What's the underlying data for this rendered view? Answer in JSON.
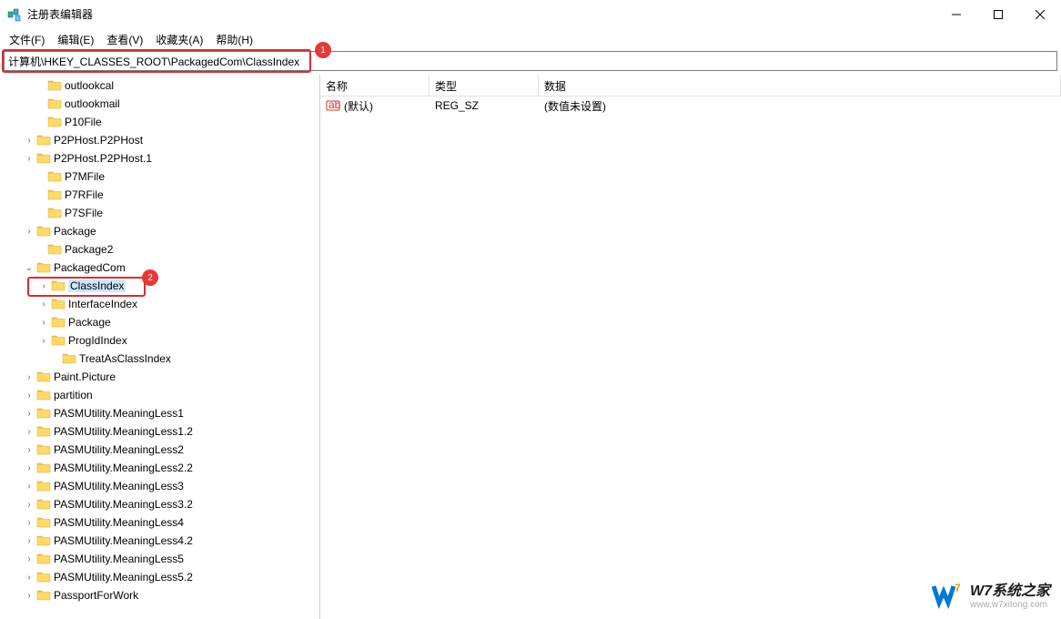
{
  "window": {
    "title": "注册表编辑器"
  },
  "menubar": {
    "file": "文件(F)",
    "edit": "编辑(E)",
    "view": "查看(V)",
    "favorites": "收藏夹(A)",
    "help": "帮助(H)"
  },
  "addressbar": {
    "path": "计算机\\HKEY_CLASSES_ROOT\\PackagedCom\\ClassIndex"
  },
  "annotations": {
    "badge1": "1",
    "badge2": "2"
  },
  "tree": [
    {
      "indent": 38,
      "arrow": "",
      "label": "outlookcal"
    },
    {
      "indent": 38,
      "arrow": "",
      "label": "outlookmail"
    },
    {
      "indent": 38,
      "arrow": "",
      "label": "P10File"
    },
    {
      "indent": 26,
      "arrow": ">",
      "label": "P2PHost.P2PHost"
    },
    {
      "indent": 26,
      "arrow": ">",
      "label": "P2PHost.P2PHost.1"
    },
    {
      "indent": 38,
      "arrow": "",
      "label": "P7MFile"
    },
    {
      "indent": 38,
      "arrow": "",
      "label": "P7RFile"
    },
    {
      "indent": 38,
      "arrow": "",
      "label": "P7SFile"
    },
    {
      "indent": 26,
      "arrow": ">",
      "label": "Package"
    },
    {
      "indent": 38,
      "arrow": "",
      "label": "Package2"
    },
    {
      "indent": 26,
      "arrow": "v",
      "label": "PackagedCom"
    },
    {
      "indent": 42,
      "arrow": ">",
      "label": "ClassIndex",
      "selected": true
    },
    {
      "indent": 42,
      "arrow": ">",
      "label": "InterfaceIndex"
    },
    {
      "indent": 42,
      "arrow": ">",
      "label": "Package"
    },
    {
      "indent": 42,
      "arrow": ">",
      "label": "ProgIdIndex"
    },
    {
      "indent": 54,
      "arrow": "",
      "label": "TreatAsClassIndex"
    },
    {
      "indent": 26,
      "arrow": ">",
      "label": "Paint.Picture"
    },
    {
      "indent": 26,
      "arrow": ">",
      "label": "partition"
    },
    {
      "indent": 26,
      "arrow": ">",
      "label": "PASMUtility.MeaningLess1"
    },
    {
      "indent": 26,
      "arrow": ">",
      "label": "PASMUtility.MeaningLess1.2"
    },
    {
      "indent": 26,
      "arrow": ">",
      "label": "PASMUtility.MeaningLess2"
    },
    {
      "indent": 26,
      "arrow": ">",
      "label": "PASMUtility.MeaningLess2.2"
    },
    {
      "indent": 26,
      "arrow": ">",
      "label": "PASMUtility.MeaningLess3"
    },
    {
      "indent": 26,
      "arrow": ">",
      "label": "PASMUtility.MeaningLess3.2"
    },
    {
      "indent": 26,
      "arrow": ">",
      "label": "PASMUtility.MeaningLess4"
    },
    {
      "indent": 26,
      "arrow": ">",
      "label": "PASMUtility.MeaningLess4.2"
    },
    {
      "indent": 26,
      "arrow": ">",
      "label": "PASMUtility.MeaningLess5"
    },
    {
      "indent": 26,
      "arrow": ">",
      "label": "PASMUtility.MeaningLess5.2"
    },
    {
      "indent": 26,
      "arrow": ">",
      "label": "PassportForWork"
    }
  ],
  "list": {
    "columns": {
      "name": "名称",
      "type": "类型",
      "data": "数据"
    },
    "rows": [
      {
        "name": "(默认)",
        "type": "REG_SZ",
        "data": "(数值未设置)"
      }
    ]
  },
  "watermark": {
    "main": "W7系统之家",
    "sub": "www.w7xitong.com"
  }
}
